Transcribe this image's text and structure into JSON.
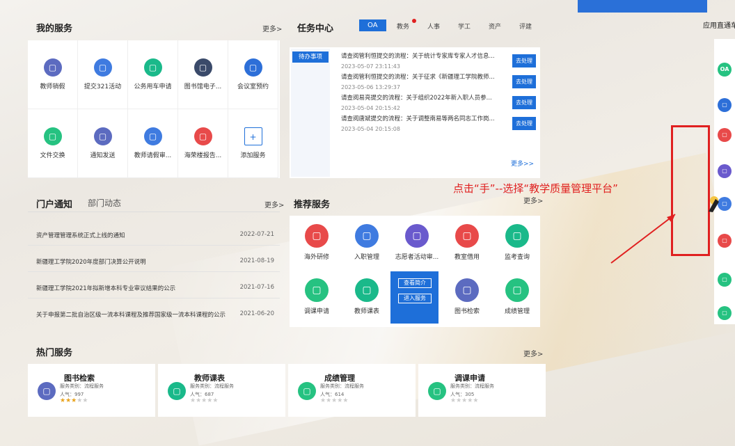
{
  "my_services": {
    "title": "我的服务",
    "more": "更多>",
    "tiles": [
      {
        "label": "教师销假",
        "icon": "leave-cancel-icon",
        "color": "#5c6bc0"
      },
      {
        "label": "提交321活动",
        "icon": "activity-icon",
        "color": "#3f7be0"
      },
      {
        "label": "公务用车申请",
        "icon": "bus-icon",
        "color": "#1ab98a"
      },
      {
        "label": "图书馆电子...",
        "icon": "library-card-icon",
        "color": "#3a4a6a"
      },
      {
        "label": "会议室预约",
        "icon": "meeting-room-icon",
        "color": "#2d6fd8"
      },
      {
        "label": "文件交换",
        "icon": "file-exchange-icon",
        "color": "#26c281"
      },
      {
        "label": "通知发送",
        "icon": "notice-send-icon",
        "color": "#5c6bc0"
      },
      {
        "label": "教师请假审...",
        "icon": "leave-approve-icon",
        "color": "#3f7be0"
      },
      {
        "label": "海荣楼报告...",
        "icon": "report-icon",
        "color": "#e84a4a"
      },
      {
        "label": "添加服务",
        "icon": "plus-icon",
        "color": "#ffffff"
      }
    ]
  },
  "task_center": {
    "title": "任务中心",
    "tabs": [
      "OA",
      "教务",
      "人事",
      "学工",
      "资产",
      "评建"
    ],
    "active_tab": "OA",
    "side_label": "待办事项",
    "more": "更多>>",
    "action": "去处理",
    "rows": [
      {
        "title": "请查阅管利恒提交的流程：关于统计专家库专家人才信息...",
        "date": "2023-05-07 23:11:43"
      },
      {
        "title": "请查阅管利恒提交的流程：关于征求《新疆理工学院教师...",
        "date": "2023-05-06 13:29:37"
      },
      {
        "title": "请查阅易亮提交的流程：关于组织2022年新入职人员参...",
        "date": "2023-05-04 20:15:42"
      },
      {
        "title": "请查阅唐斌提交的流程：关于调整南易等两名同志工作岗...",
        "date": "2023-05-04 20:15:08"
      }
    ]
  },
  "portal": {
    "tab1": "门户通知",
    "tab2": "部门动态",
    "more": "更多>",
    "items": [
      {
        "title": "资产管理管理系统正式上线的通知",
        "date": "2022-07-21"
      },
      {
        "title": "新疆理工学院2020年度部门决算公开说明",
        "date": "2021-08-19"
      },
      {
        "title": "新疆理工学院2021年拟新增本科专业审议结果的公示",
        "date": "2021-07-16"
      },
      {
        "title": "关于申报第二批自治区级一流本科课程及推荐国家级一流本科课程的公示",
        "date": "2021-06-20"
      }
    ]
  },
  "recommend": {
    "title": "推荐服务",
    "more": "更多>",
    "items": [
      {
        "label": "海外研修",
        "icon": "overseas-icon",
        "color": "#e84a4a"
      },
      {
        "label": "入职管理",
        "icon": "onboard-icon",
        "color": "#3f7be0"
      },
      {
        "label": "志愿者活动审...",
        "icon": "volunteer-icon",
        "color": "#6a5acd"
      },
      {
        "label": "教室借用",
        "icon": "classroom-icon",
        "color": "#e84a4a"
      },
      {
        "label": "监考查询",
        "icon": "shield-check-icon",
        "color": "#1ab98a"
      },
      {
        "label": "调课申请",
        "icon": "swap-icon",
        "color": "#26c281"
      },
      {
        "label": "教师课表",
        "icon": "schedule-icon",
        "color": "#1ab98a"
      },
      {
        "label": "图书检索",
        "icon": "book-search-icon",
        "color": "#5c6bc0"
      },
      {
        "label": "成绩管理",
        "icon": "grade-icon",
        "color": "#26c281"
      }
    ],
    "popup": {
      "intro": "查看简介",
      "enter": "进入服务"
    }
  },
  "hot": {
    "title": "热门服务",
    "more": "更多>",
    "items": [
      {
        "name": "图书检索",
        "category": "服务类别：流程服务",
        "popularity": "人气：997",
        "stars": 3,
        "color": "#5c6bc0"
      },
      {
        "name": "教师课表",
        "category": "服务类别：流程服务",
        "popularity": "人气：687",
        "stars": 0,
        "color": "#1ab98a"
      },
      {
        "name": "成绩管理",
        "category": "服务类别：流程服务",
        "popularity": "人气：614",
        "stars": 0,
        "color": "#26c281"
      },
      {
        "name": "调课申请",
        "category": "服务类别：流程服务",
        "popularity": "人气：305",
        "stars": 0,
        "color": "#26c281"
      }
    ]
  },
  "sidebar": {
    "title": "应用直通车",
    "items": [
      {
        "label": "OA",
        "color": "#26c281"
      },
      {
        "label": "",
        "color": "#2d6fd8"
      },
      {
        "label": "",
        "color": "#e84a4a"
      },
      {
        "label": "",
        "color": "#6a5acd"
      },
      {
        "label": "",
        "color": "#3f7be0"
      },
      {
        "label": "",
        "color": "#e84a4a"
      },
      {
        "label": "",
        "color": "#26c281"
      },
      {
        "label": "",
        "color": "#26c281"
      }
    ]
  },
  "annotation": {
    "text": "点击“手”--选择“教学质量管理平台”",
    "color": "#e02020"
  }
}
